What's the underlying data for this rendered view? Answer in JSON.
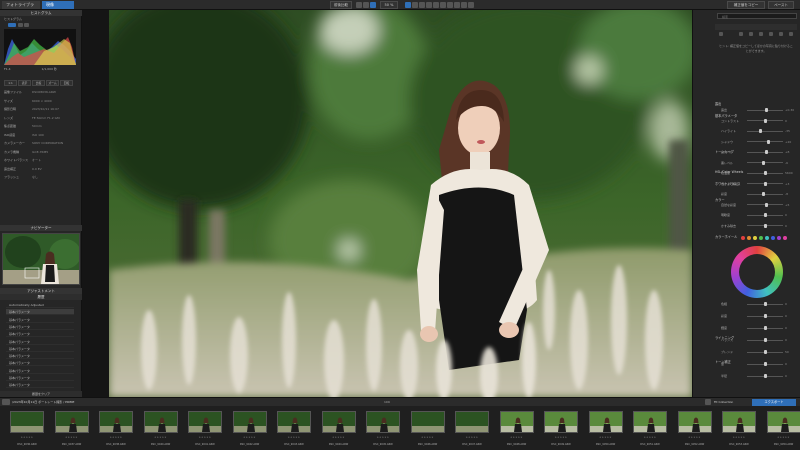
{
  "topbar": {
    "tab_library": "フォトライブラリ",
    "tab_develop": "現像",
    "btn_compare": "前後比較",
    "zoom": "50 %",
    "btn_sync": "補正値をコピー",
    "btn_paste": "ペースト"
  },
  "left": {
    "histogram_header": "ヒストグラム",
    "histogram_label": "ヒストグラム",
    "exif_values": {
      "ev": "F1.4",
      "speed": "1/1,000 秒"
    },
    "mode_buttons": [
      "1:1",
      "表示",
      "比較",
      "ズーム",
      "回転"
    ],
    "info_rows": [
      {
        "k": "画像ファイル",
        "v": "DSC08036.ARW"
      },
      {
        "k": "サイズ",
        "v": "6000 × 4000"
      },
      {
        "k": "撮影日時",
        "v": "2023/10/11 16:07"
      },
      {
        "k": "レンズ",
        "v": "FE 50mm F1.2 GM"
      },
      {
        "k": "焦点距離",
        "v": "50mm"
      },
      {
        "k": "ISO感度",
        "v": "ISO 100"
      },
      {
        "k": "カメラメーカー",
        "v": "SONY CORPORATION"
      },
      {
        "k": "カメラ機種",
        "v": "ILCE-7RM5"
      },
      {
        "k": "ホワイトバランス",
        "v": "オート"
      },
      {
        "k": "露出補正",
        "v": "0.0 EV"
      },
      {
        "k": "フラッシュ",
        "v": "なし"
      }
    ],
    "navigator_header": "ナビゲーター",
    "adjust_header": "アジャストメント",
    "history_header": "履歴",
    "history_items": [
      "Automatically Adjusted",
      "基本パラメータ",
      "基本パラメータ",
      "基本パラメータ",
      "基本パラメータ",
      "基本パラメータ",
      "基本パラメータ",
      "基本パラメータ",
      "基本パラメータ",
      "基本パラメータ",
      "基本パラメータ",
      "基本パラメータ"
    ],
    "history_footer": "履歴をクリア"
  },
  "right": {
    "search_placeholder": "検索",
    "notice": "ヒント: 補正値をコピーしてほかの写真に貼り付けることができます。",
    "sections": [
      "露出",
      "基本パラメータ",
      "トーンカーブ",
      "HSL/Color Wheels",
      "ホワイトバランス",
      "カラー",
      "カラーホイール",
      "ライトニング",
      "トーン補正"
    ],
    "sliders": [
      {
        "label": "露出",
        "value": "+0.30",
        "pos": 0.55
      },
      {
        "label": "コントラスト",
        "value": "0",
        "pos": 0.5
      },
      {
        "label": "ハイライト",
        "value": "-35",
        "pos": 0.35
      },
      {
        "label": "シャドウ",
        "value": "+20",
        "pos": 0.62
      },
      {
        "label": "白レベル",
        "value": "+8",
        "pos": 0.54
      },
      {
        "label": "黒レベル",
        "value": "-6",
        "pos": 0.46
      },
      {
        "label": "色温度",
        "value": "5600",
        "pos": 0.5
      },
      {
        "label": "色かぶり補正",
        "value": "+3",
        "pos": 0.52
      },
      {
        "label": "彩度",
        "value": "-8",
        "pos": 0.45
      },
      {
        "label": "自然な彩度",
        "value": "+5",
        "pos": 0.55
      },
      {
        "label": "明瞭度",
        "value": "0",
        "pos": 0.5
      },
      {
        "label": "かすみ除去",
        "value": "0",
        "pos": 0.5
      }
    ],
    "lower_sliders": [
      {
        "label": "色相",
        "value": "0",
        "pos": 0.5
      },
      {
        "label": "彩度",
        "value": "0",
        "pos": 0.5
      },
      {
        "label": "輝度",
        "value": "0",
        "pos": 0.5
      },
      {
        "label": "バランス",
        "value": "0",
        "pos": 0.5
      },
      {
        "label": "ブレンド",
        "value": "50",
        "pos": 0.5
      },
      {
        "label": "量",
        "value": "0",
        "pos": 0.5
      },
      {
        "label": "半径",
        "value": "0",
        "pos": 0.5
      }
    ],
    "colors": [
      "#e04040",
      "#e08a30",
      "#e0d040",
      "#50c050",
      "#40c0c0",
      "#4060e0",
      "#a040d0",
      "#e040a0"
    ]
  },
  "filmbar": {
    "path": "/2023年10月11日 ポートレート撮影 / PRIME",
    "count": "109",
    "filter": "Default",
    "collection": "Fit Collection",
    "export_button": "エクスポート"
  },
  "film": [
    {
      "name": "DSC_9036.ARW",
      "bright": false,
      "person": false
    },
    {
      "name": "DSC_9037.ARW",
      "bright": false,
      "person": true
    },
    {
      "name": "DSC_9038.ARW",
      "bright": false,
      "person": true
    },
    {
      "name": "DSC_9040.ARW",
      "bright": false,
      "person": true
    },
    {
      "name": "DSC_9041.ARW",
      "bright": false,
      "person": true
    },
    {
      "name": "DSC_9042.ARW",
      "bright": false,
      "person": true
    },
    {
      "name": "DSC_9043.ARW",
      "bright": false,
      "person": true
    },
    {
      "name": "DSC_9044.ARW",
      "bright": false,
      "person": true
    },
    {
      "name": "DSC_9045.ARW",
      "bright": false,
      "person": true
    },
    {
      "name": "DSC_9046.ARW",
      "bright": false,
      "person": false
    },
    {
      "name": "DSC_9047.ARW",
      "bright": false,
      "person": false
    },
    {
      "name": "DSC_9048.ARW",
      "bright": true,
      "person": true
    },
    {
      "name": "DSC_9049.ARW",
      "bright": true,
      "person": true
    },
    {
      "name": "DSC_9050.ARW",
      "bright": true,
      "person": true
    },
    {
      "name": "DSC_9051.ARW",
      "bright": true,
      "person": true
    },
    {
      "name": "DSC_9052.ARW",
      "bright": true,
      "person": true
    },
    {
      "name": "DSC_9053.ARW",
      "bright": true,
      "person": true
    },
    {
      "name": "DSC_9054.ARW",
      "bright": true,
      "person": true
    }
  ]
}
